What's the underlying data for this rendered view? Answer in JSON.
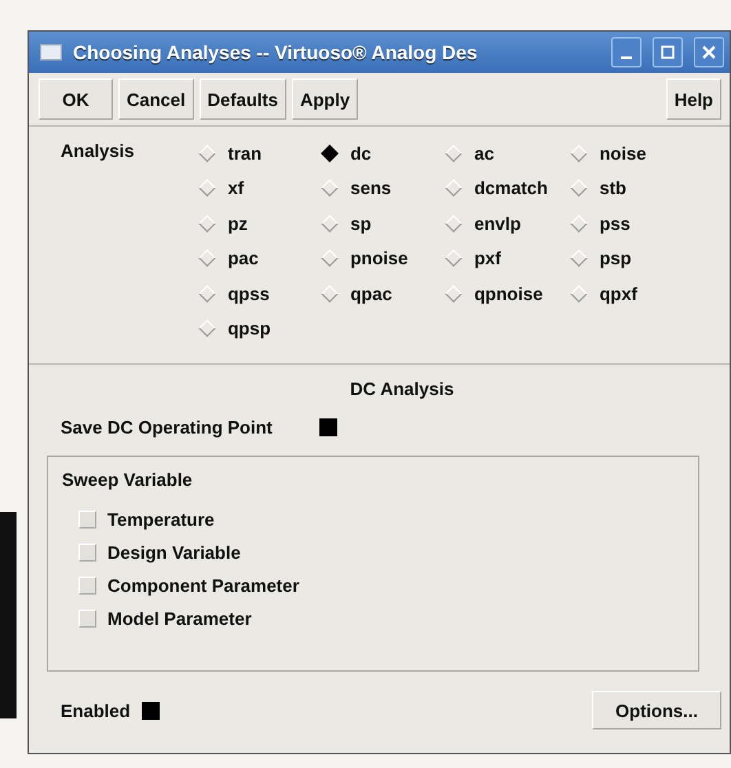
{
  "window": {
    "title": "Choosing Analyses -- Virtuoso® Analog Des"
  },
  "buttons": [
    {
      "label": "OK"
    },
    {
      "label": "Cancel"
    },
    {
      "label": "Defaults"
    },
    {
      "label": "Apply"
    }
  ],
  "help": "Help",
  "analysis": {
    "label": "Analysis",
    "options": [
      {
        "label": "tran",
        "selected": false
      },
      {
        "label": "dc",
        "selected": true
      },
      {
        "label": "ac",
        "selected": false
      },
      {
        "label": "noise",
        "selected": false
      },
      {
        "label": "xf",
        "selected": false
      },
      {
        "label": "sens",
        "selected": false
      },
      {
        "label": "dcmatch",
        "selected": false
      },
      {
        "label": "stb",
        "selected": false
      },
      {
        "label": "pz",
        "selected": false
      },
      {
        "label": "sp",
        "selected": false
      },
      {
        "label": "envlp",
        "selected": false
      },
      {
        "label": "pss",
        "selected": false
      },
      {
        "label": "pac",
        "selected": false
      },
      {
        "label": "pnoise",
        "selected": false
      },
      {
        "label": "pxf",
        "selected": false
      },
      {
        "label": "psp",
        "selected": false
      },
      {
        "label": "qpss",
        "selected": false
      },
      {
        "label": "qpac",
        "selected": false
      },
      {
        "label": "qpnoise",
        "selected": false
      },
      {
        "label": "qpxf",
        "selected": false
      },
      {
        "label": "qpsp",
        "selected": false
      }
    ]
  },
  "section_title": "DC Analysis",
  "save_dc": {
    "label": "Save DC Operating Point",
    "checked": true
  },
  "sweep": {
    "title": "Sweep Variable",
    "options": [
      {
        "label": "Temperature",
        "checked": false
      },
      {
        "label": "Design Variable",
        "checked": false
      },
      {
        "label": "Component Parameter",
        "checked": false
      },
      {
        "label": "Model Parameter",
        "checked": false
      }
    ]
  },
  "enabled": {
    "label": "Enabled",
    "checked": true
  },
  "options_button": "Options..."
}
